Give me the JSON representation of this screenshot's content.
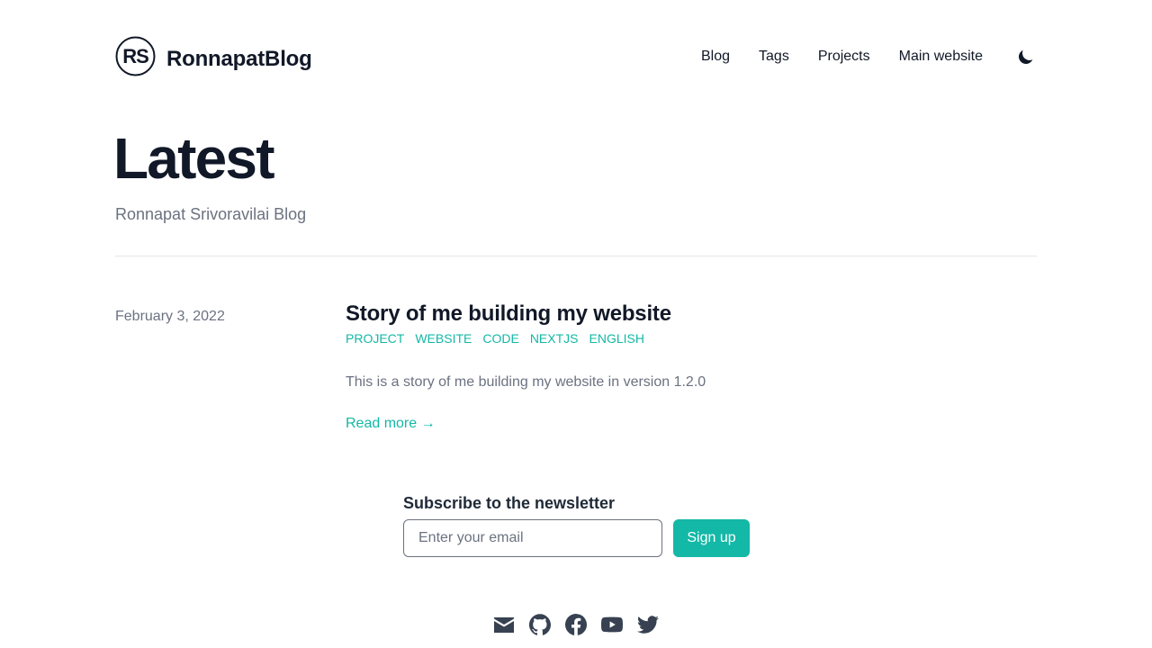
{
  "header": {
    "logo_text": "RS",
    "site_title": "RonnapatBlog",
    "nav": [
      {
        "label": "Blog"
      },
      {
        "label": "Tags"
      },
      {
        "label": "Projects"
      },
      {
        "label": "Main website"
      }
    ],
    "theme_toggle_icon": "moon-icon"
  },
  "hero": {
    "title": "Latest",
    "subtitle": "Ronnapat Srivoravilai Blog"
  },
  "posts": [
    {
      "date": "February 3, 2022",
      "title": "Story of me building my website",
      "tags": [
        "PROJECT",
        "WEBSITE",
        "CODE",
        "NEXTJS",
        "ENGLISH"
      ],
      "summary": "This is a story of me building my website in version 1.2.0",
      "read_more": "Read more →"
    }
  ],
  "newsletter": {
    "title": "Subscribe to the newsletter",
    "placeholder": "Enter your email",
    "button": "Sign up"
  },
  "social_icons": [
    "mail-icon",
    "github-icon",
    "facebook-icon",
    "youtube-icon",
    "twitter-icon"
  ],
  "colors": {
    "accent": "#14b8a6",
    "text": "#111827",
    "muted": "#6b7280",
    "divider": "#e5e7eb",
    "icon": "#374151"
  }
}
